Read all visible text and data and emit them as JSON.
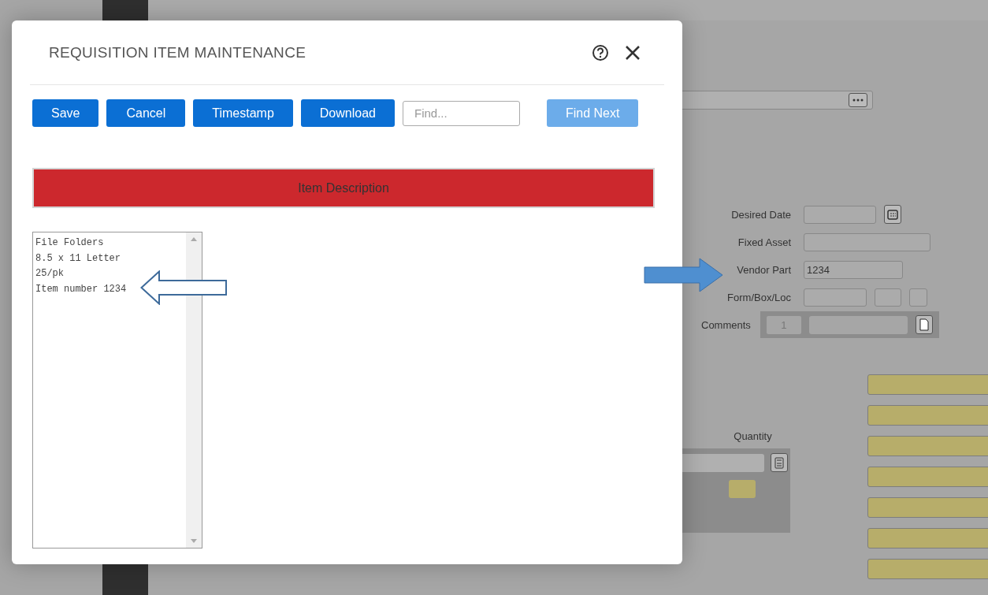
{
  "dialog": {
    "title": "REQUISITION ITEM MAINTENANCE",
    "buttons": [
      {
        "label": "Save"
      },
      {
        "label": "Cancel"
      },
      {
        "label": "Timestamp"
      },
      {
        "label": "Download"
      }
    ],
    "find": {
      "placeholder": "Find..."
    },
    "find_next": {
      "label": "Find Next",
      "disabled": true
    },
    "section_header": "Item Description",
    "description_lines": [
      "File Folders",
      "8.5 x 11 Letter",
      "25/pk",
      "Item number 1234"
    ]
  },
  "background_form": {
    "fields": [
      {
        "kind": "date",
        "label": "Desired Date"
      },
      {
        "kind": "text",
        "label": "Fixed Asset"
      },
      {
        "kind": "short",
        "label": "Vendor Part",
        "value": "1234"
      },
      {
        "kind": "triple",
        "label": "Form/Box/Loc"
      }
    ],
    "comments": {
      "label": "Comments",
      "count": "1"
    },
    "quantity": {
      "label": "Quantity"
    },
    "highlight_fields": [
      {
        "kind": "highlighted"
      },
      {
        "kind": "highlighted"
      },
      {
        "kind": "highlighted"
      },
      {
        "kind": "highlighted"
      },
      {
        "kind": "highlighted"
      },
      {
        "kind": "highlighted"
      },
      {
        "kind": "highlighted"
      }
    ]
  }
}
